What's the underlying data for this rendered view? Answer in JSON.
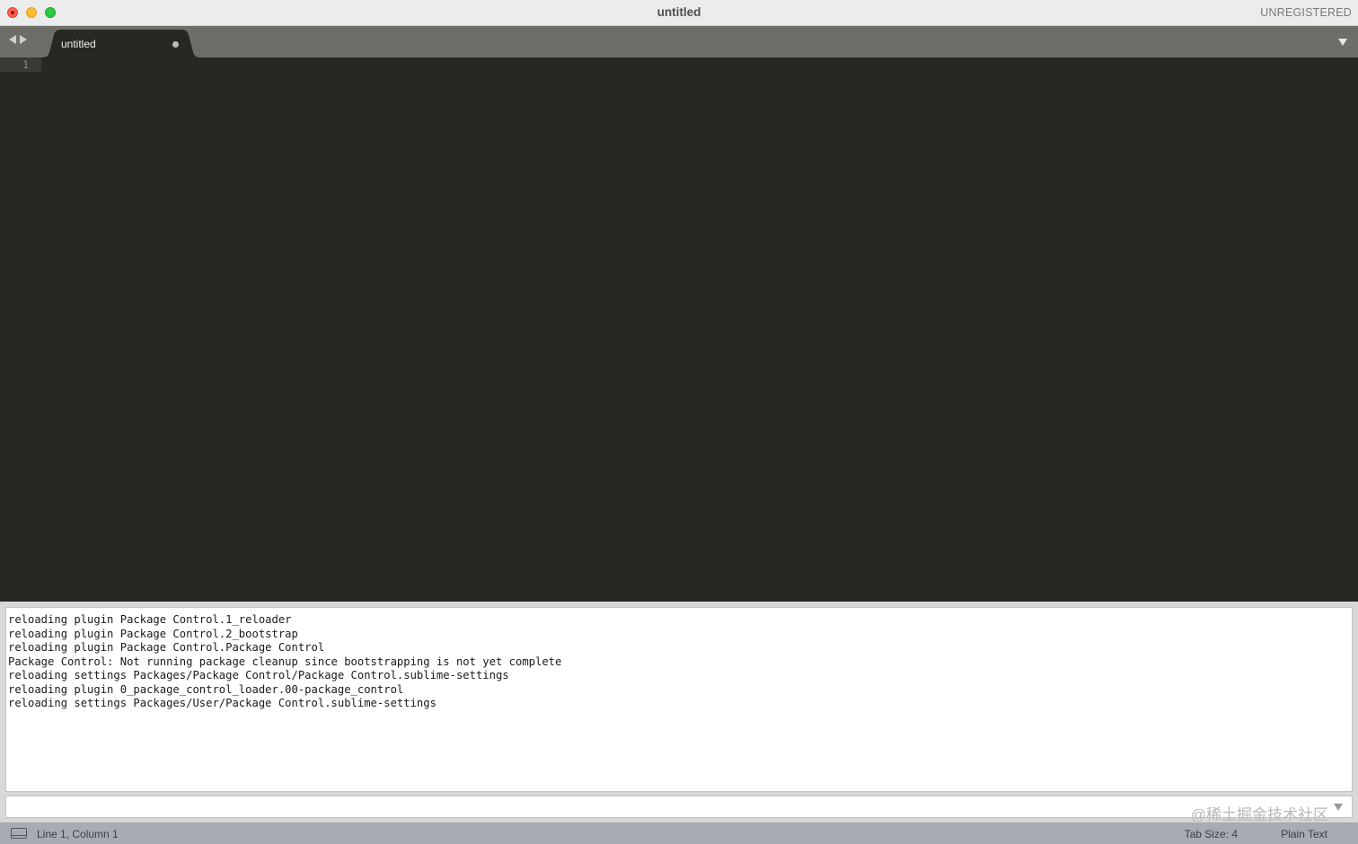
{
  "window": {
    "title": "untitled",
    "registration": "UNREGISTERED"
  },
  "tabs": [
    {
      "label": "untitled",
      "modified": true
    }
  ],
  "editor": {
    "line_numbers": [
      "1"
    ]
  },
  "console": {
    "lines": [
      "reloading plugin Package Control.1_reloader",
      "reloading plugin Package Control.2_bootstrap",
      "reloading plugin Package Control.Package Control",
      "Package Control: Not running package cleanup since bootstrapping is not yet complete",
      "reloading settings Packages/Package Control/Package Control.sublime-settings",
      "reloading plugin 0_package_control_loader.00-package_control",
      "reloading settings Packages/User/Package Control.sublime-settings"
    ],
    "input_value": "",
    "watermark": "@稀土掘金技术社区"
  },
  "statusbar": {
    "position": "Line 1, Column 1",
    "tab_size": "Tab Size: 4",
    "syntax": "Plain Text"
  },
  "colors": {
    "editor_bg": "#272822",
    "tabbar_bg": "#6e6e69",
    "statusbar_bg": "#a8abb3",
    "close": "#ff5f57",
    "minimize": "#febc2e",
    "maximize": "#28c840"
  },
  "icons": {
    "close": "close-icon",
    "minimize": "minimize-icon",
    "maximize": "maximize-icon",
    "nav_back": "chevron-left-icon",
    "nav_forward": "chevron-right-icon",
    "tab_list": "chevron-down-icon",
    "panel_toggle": "panel-icon"
  }
}
